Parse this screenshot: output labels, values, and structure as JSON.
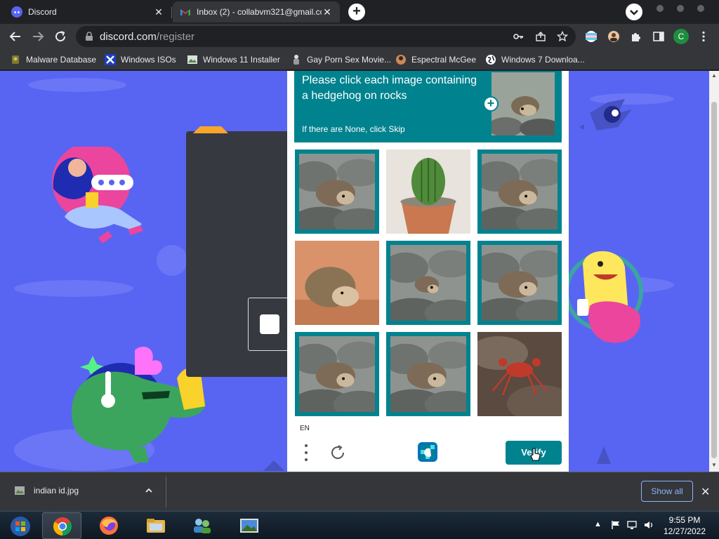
{
  "browser": {
    "tabs": [
      {
        "label": "Discord"
      },
      {
        "label": "Inbox (2) - collabvm321@gmail.com"
      }
    ],
    "profile_initial": "C",
    "url": {
      "host": "discord.com",
      "path": "/register"
    },
    "bookmarks": [
      {
        "label": "Malware Database"
      },
      {
        "label": "Windows ISOs"
      },
      {
        "label": "Windows 11 Installer"
      },
      {
        "label": "Gay Porn Sex Movie..."
      },
      {
        "label": "Espectral McGee"
      },
      {
        "label": "Windows 7 Downloa..."
      }
    ]
  },
  "captcha": {
    "prompt_title": "Please click each image containing a hedgehog on rocks",
    "prompt_sub": "If there are None, click Skip",
    "language": "EN",
    "verify_label": "Verify",
    "tiles": [
      {
        "content": "hedgehog on rocks",
        "selected": true
      },
      {
        "content": "cactus in pot",
        "selected": false
      },
      {
        "content": "hedgehog on rock",
        "selected": true
      },
      {
        "content": "hedgehog on sand",
        "selected": false
      },
      {
        "content": "small hedgehog on rocks",
        "selected": true
      },
      {
        "content": "hedgehog on rocks",
        "selected": true
      },
      {
        "content": "hedgehog on rocks",
        "selected": true
      },
      {
        "content": "hedgehog on rocks",
        "selected": true
      },
      {
        "content": "crab on rocks",
        "selected": false
      }
    ]
  },
  "downloads": {
    "file_name": "indian id.jpg",
    "show_all_label": "Show all"
  },
  "taskbar": {
    "time": "9:55 PM",
    "date": "12/27/2022"
  },
  "colors": {
    "discord_blurple": "#5865f2",
    "hcaptcha_teal": "#00838f"
  }
}
